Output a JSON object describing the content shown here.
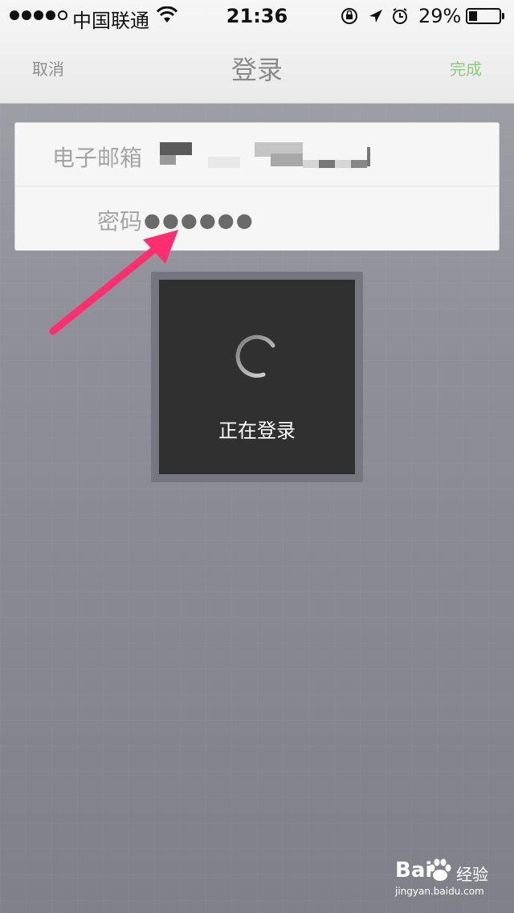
{
  "status_bar": {
    "carrier": "中国联通",
    "time": "21:36",
    "battery_percent": "29%",
    "battery_level": 0.29,
    "signal_bars": 4,
    "signal_max": 5
  },
  "nav": {
    "cancel_label": "取消",
    "title": "登录",
    "done_label": "完成",
    "done_color": "#8ccc7e"
  },
  "form": {
    "email_label": "电子邮箱",
    "password_label": "密码",
    "password_value": "●●●●●●"
  },
  "hud": {
    "message": "正在登录"
  },
  "watermark": {
    "brand": "Bai",
    "brand_cn": "经验",
    "url": "jingyan.baidu.com"
  },
  "colors": {
    "annotation_arrow": "#ff2e6e",
    "hud_background": "#303030"
  }
}
